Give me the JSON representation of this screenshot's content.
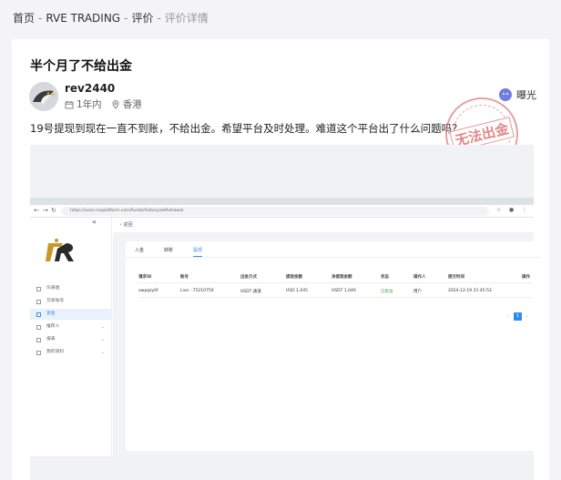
{
  "breadcrumb": {
    "home": "首页",
    "brand": "RVE TRADING",
    "section": "评价",
    "current": "评价详情",
    "sep": "-"
  },
  "post": {
    "title": "半个月了不给出金",
    "username": "rev2440",
    "time": "1年内",
    "location": "香港",
    "expose_label": "曝光",
    "content": "19号提现到现在一直不到账，不给出金。希望平台及时处理。难道这个平台出了什么问题吗？",
    "stamp_text": "无法出金"
  },
  "screenshot": {
    "url": "https://user.rveplatform.com/funds/history/withdrawal",
    "collapse": "«",
    "menu": [
      {
        "label": "仪表盘",
        "chev": ""
      },
      {
        "label": "交易账号",
        "chev": ""
      },
      {
        "label": "资金",
        "chev": ""
      },
      {
        "label": "推荐人",
        "chev": "⌄"
      },
      {
        "label": "报表",
        "chev": "⌄"
      },
      {
        "label": "我的资料",
        "chev": "⌄"
      }
    ],
    "back_label": "‹  返回",
    "tabs": [
      "入金",
      "转账",
      "提现"
    ],
    "table_headers": [
      "请求ID",
      "账号",
      "出金方式",
      "提现金额",
      "净提现金额",
      "状态",
      "操作人",
      "提交时间",
      "操作"
    ],
    "table_row": [
      "awpqzy0f",
      "Live - 75210750",
      "USDT 通道",
      "USD 1,045",
      "USDT 1,040",
      "已批准",
      "用户",
      "2024-12-19 21:45:53",
      ""
    ],
    "pager": {
      "prev": "‹",
      "page": "1",
      "next": "›"
    }
  },
  "colors": {
    "accent": "#2d8cf0",
    "stamp": "#d04646",
    "approved": "#3aa85a"
  }
}
